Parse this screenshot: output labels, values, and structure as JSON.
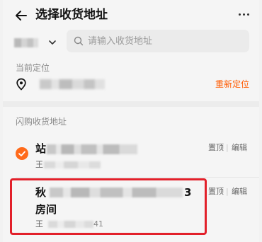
{
  "header": {
    "title": "选择收货地址"
  },
  "search": {
    "placeholder": "请输入收货地址"
  },
  "current_location": {
    "label": "当前定位",
    "relocate_label": "重新定位"
  },
  "address_section": {
    "label": "闪购收货地址"
  },
  "addresses": [
    {
      "name_visible_prefix": "站",
      "contact_visible_prefix": "王",
      "selected": true,
      "pin_top_label": "置顶",
      "edit_label": "编辑"
    },
    {
      "name_visible_prefix": "秋",
      "name_visible_suffix": "3",
      "name_line2": "房间",
      "contact_visible_prefix": "王",
      "contact_visible_suffix": "41",
      "selected": false,
      "pin_top_label": "置顶",
      "edit_label": "编辑"
    }
  ],
  "colors": {
    "accent": "#ff5a00",
    "highlight_border": "#e2202a"
  }
}
